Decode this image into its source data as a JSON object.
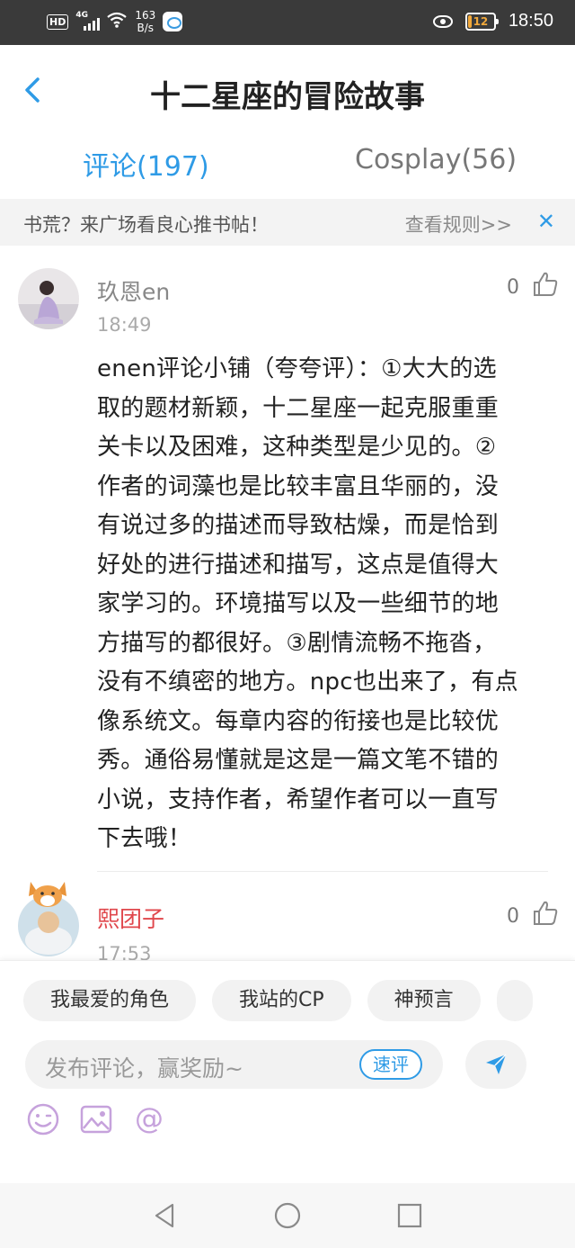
{
  "status_bar": {
    "hd": "HD",
    "network": "4G",
    "speed_value": "163",
    "speed_unit": "B/s",
    "battery": "12",
    "time": "18:50"
  },
  "header": {
    "title": "十二星座的冒险故事",
    "back_icon": "chevron-left-icon"
  },
  "tabs": [
    {
      "label": "评论(197)",
      "active": true
    },
    {
      "label": "Cosplay(56)",
      "active": false
    }
  ],
  "banner": {
    "text": "书荒？来广场看良心推书帖！",
    "rules_link": "查看规则>>",
    "close_icon": "close-icon"
  },
  "comments": [
    {
      "username": "玖恩en",
      "time": "18:49",
      "likes": "0",
      "body_lines": [
        "enen评论小铺（夸夸评）：①大大的选",
        "取的题材新颖，十二星座一起克服重重",
        "关卡以及困难，这种类型是少见的。②",
        "作者的词藻也是比较丰富且华丽的，没",
        "有说过多的描述而导致枯燥，而是恰到",
        "好处的进行描述和描写，这点是值得大",
        "家学习的。环境描写以及一些细节的地",
        "方描写的都很好。③剧情流畅不拖沓，",
        "没有不缜密的地方。npc也出来了，有点",
        "像系统文。每章内容的衔接也是比较优",
        "秀。通俗易懂就是这是一篇文笔不错的",
        "小说，支持作者，希望作者可以一直写",
        "下去哦！"
      ]
    },
    {
      "username": "熙团子",
      "time": "17:53",
      "likes": "0"
    }
  ],
  "bottom_panel": {
    "chips": [
      "我最爱的角色",
      "我站的CP",
      "神预言"
    ],
    "input_placeholder": "发布评论，赢奖励~",
    "quick_review": "速评",
    "tools": [
      "emoji-icon",
      "image-icon",
      "mention-icon"
    ]
  },
  "colors": {
    "accent": "#2f9be6",
    "username_highlight": "#e0474c",
    "status_bar": "#3a3a3a"
  }
}
